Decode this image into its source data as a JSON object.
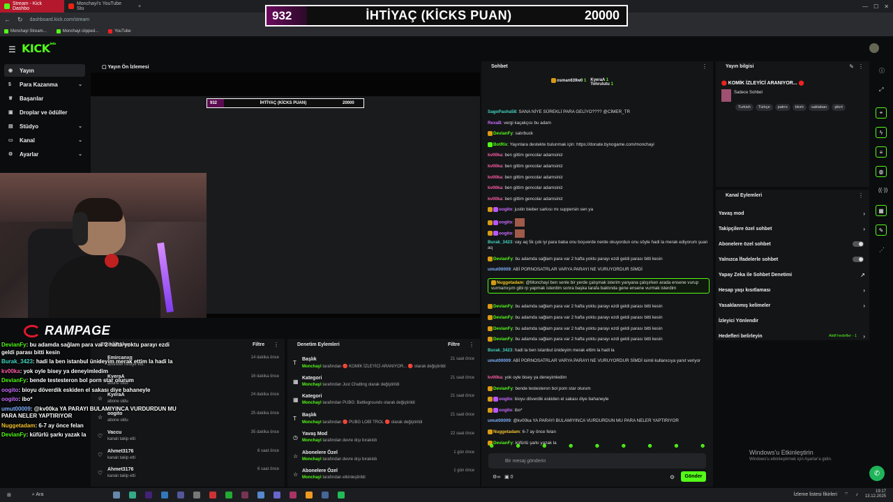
{
  "browser": {
    "tabs": [
      {
        "label": "Stream - Kick Dashbo"
      },
      {
        "label": "Monchayi's YouTube Stu"
      }
    ],
    "url": "dashboard.kick.com/stream",
    "bookmarks": [
      {
        "label": "Monchayi Stream..."
      },
      {
        "label": "Monchayi clipped..."
      },
      {
        "label": "YouTube"
      }
    ]
  },
  "overlay_counter": {
    "current": "932",
    "title": "İHTİYAÇ (KİCKS PUAN)",
    "goal": "20000"
  },
  "kick": {
    "logo": "KICK",
    "logo_sup": "beta"
  },
  "sidebar": {
    "items": [
      {
        "label": "Yayın",
        "icon": "broadcast-icon",
        "expandable": false
      },
      {
        "label": "Para Kazanma",
        "icon": "money-icon",
        "expandable": true
      },
      {
        "label": "Başarılar",
        "icon": "trophy-icon",
        "expandable": false
      },
      {
        "label": "Droplar ve ödüller",
        "icon": "gift-icon",
        "expandable": false
      },
      {
        "label": "Stüdyo",
        "icon": "studio-icon",
        "expandable": true
      },
      {
        "label": "Kanal",
        "icon": "channel-icon",
        "expandable": true
      },
      {
        "label": "Ayarlar",
        "icon": "gear-icon",
        "expandable": true
      }
    ]
  },
  "preview": {
    "title": "Yayın Ön İzlemesi",
    "brand": "RAMPAGE"
  },
  "stream_chat_overlay": [
    {
      "user": "DevianFy",
      "color": "green",
      "text": "bu adamda sağlam para var 2 hafta yoktu parayı ezdi geldi parası bitti kesin"
    },
    {
      "user": "Burak_3423",
      "color": "cyan",
      "text": "hadi la ben istanbul ünideyim merak ettim la hadi la"
    },
    {
      "user": "kv00ka",
      "color": "pink",
      "text": "yok oyle bisey ya deneyimledim"
    },
    {
      "user": "DevianFy",
      "color": "green",
      "text": "bende testesteron bol porn star olurum"
    },
    {
      "user": "oogito",
      "color": "purple",
      "text": "bioyu döverdik eskiden el sakası diye bahaneyle"
    },
    {
      "user": "oogito",
      "color": "purple",
      "text": "ibo*"
    },
    {
      "user": "umut00009",
      "color": "blue",
      "text": "@kv00ka YA PARAYI BULAMIYINCA VURDURDUN MU PARA NELER YAPTIRIYOR"
    },
    {
      "user": "Nuggetadam",
      "color": "yellow",
      "text": "6-7 ay önce felan"
    },
    {
      "user": "DevianFy",
      "color": "green",
      "text": "küfürlü şarkı yazak la"
    }
  ],
  "activity": {
    "title": "Etkinlik Akışı",
    "filter": "Filtre",
    "items": [
      {
        "name": "Emircanxq",
        "sub": "abonelik hediye etti.",
        "time": "14 dakika önce",
        "icon": "gift-icon"
      },
      {
        "name": "KyeraA",
        "sub": "abone oldu",
        "time": "16 dakika önce",
        "icon": "star-icon"
      },
      {
        "name": "KyeraA",
        "sub": "abone oldu",
        "time": "24 dakika önce",
        "icon": "star-icon"
      },
      {
        "name": "oogito",
        "sub": "abone oldu",
        "time": "25 dakika önce",
        "icon": "star-icon"
      },
      {
        "name": "Vaccu",
        "sub": "kanalı takip etti",
        "time": "35 dakika önce",
        "icon": "heart-icon"
      },
      {
        "name": "Ahmet3176",
        "sub": "kanalı takip etti",
        "time": "6 saat önce",
        "icon": "heart-icon"
      },
      {
        "name": "Ahmet3176",
        "sub": "kanalı takip etti",
        "time": "6 saat önce",
        "icon": "heart-icon"
      }
    ]
  },
  "modlog": {
    "title": "Denetim Eylemleri",
    "filter": "Filtre",
    "items": [
      {
        "name": "Başlık",
        "actor": "Monchayi",
        "sub": "tarafından 🔴 KOMİK İZLEYİCİ ARANIYOR... 🔴 olarak değiştirildi",
        "time": "21 saat önce",
        "icon": "title-icon"
      },
      {
        "name": "Kategori",
        "actor": "Monchayi",
        "sub": "tarafından Just Chatting olarak değiştirildi",
        "time": "21 saat önce",
        "icon": "category-icon"
      },
      {
        "name": "Kategori",
        "actor": "Monchayi",
        "sub": "tarafından PUBG: Battlegrounds olarak değiştirildi",
        "time": "21 saat önce",
        "icon": "category-icon"
      },
      {
        "name": "Başlık",
        "actor": "Monchayi",
        "sub": "tarafından 🔴 PUBG LOBİ TROL 🔴 olarak değiştirildi",
        "time": "21 saat önce",
        "icon": "title-icon"
      },
      {
        "name": "Yavaş Mod",
        "actor": "Monchayi",
        "sub": "tarafından devre dışı bırakıldı",
        "time": "22 saat önce",
        "icon": "slow-icon"
      },
      {
        "name": "Abonelere Özel",
        "actor": "Monchayi",
        "sub": "tarafından devre dışı bırakıldı",
        "time": "1 gün önce",
        "icon": "sub-icon"
      },
      {
        "name": "Abonelere Özel",
        "actor": "Monchayi",
        "sub": "tarafından etkinleştirildi",
        "time": "1 gün önce",
        "icon": "sub-icon"
      }
    ]
  },
  "chat": {
    "title": "Sohbet",
    "leaders": [
      {
        "name": "osman639w0",
        "count": "1"
      },
      {
        "name": "KyeraA",
        "count": "1"
      },
      {
        "name": "Tohrulutu",
        "count": "1"
      }
    ],
    "messages": [
      {
        "user": "SagoPasha58",
        "color": "cyan",
        "text": "SANA NİYE SÜREKLİ PARA GELİYO???? @CİMER_TR"
      },
      {
        "user": "RexaB",
        "color": "purple",
        "text": "vergi kaçakçısı bu adam"
      },
      {
        "user": "DevianFy",
        "color": "green",
        "text": "satırbuck"
      },
      {
        "user": "BotRix",
        "color": "green",
        "text": "Yayınlara destekte bulunmak için: https://donate.bynogame.com/monchayi"
      },
      {
        "user": "kv00ka",
        "color": "pink",
        "text": "ben gittim gencolar adamsiniz"
      },
      {
        "user": "kv00ka",
        "color": "pink",
        "text": "ben gittim gencolar adamsiniz"
      },
      {
        "user": "kv00ka",
        "color": "pink",
        "text": "ben gittim gencolar adamsiniz"
      },
      {
        "user": "kv00ka",
        "color": "pink",
        "text": "ben gittim gencolar adamsiniz"
      },
      {
        "user": "kv00ka",
        "color": "pink",
        "text": "ben gittim gencolar adamsiniz"
      },
      {
        "user": "oogito",
        "color": "purple",
        "text": "justin bieber sarkısı mı suppersin sen ya"
      },
      {
        "user": "oogito",
        "color": "purple",
        "text": ""
      },
      {
        "user": "oogito",
        "color": "purple",
        "text": ""
      },
      {
        "user": "Burak_3423",
        "color": "cyan",
        "text": "vay aq 5k çok iyi para baba onu boşverde nerde okuyordun onu söyle hadi la merak ediyorum şuan aq"
      },
      {
        "user": "DevianFy",
        "color": "green",
        "text": "bu adamda sağlam para var 2 hafta yoktu parayı ezdi geldi parası bitti kesin"
      },
      {
        "user": "umut00009",
        "color": "blue",
        "text": "ABİ PORNOSATRLAR VARYA PARAYI NE VURUYORDUR SİMDİ"
      },
      {
        "user": "Nuggetadam",
        "color": "yellow",
        "text": "@Monchayi ben senle bir yerde çalışmak isterim yanyana çalışırken arada ensene vurup vurmamışım gibi rp yapmak isterdim sonra başka tarafa baktında gene ensene vurmak isterdim"
      },
      {
        "user": "DevianFy",
        "color": "green",
        "text": "bu adamda sağlam para var 2 hafta yoktu parayı ezdi geldi parası bitti kesin"
      },
      {
        "user": "DevianFy",
        "color": "green",
        "text": "bu adamda sağlam para var 2 hafta yoktu parayı ezdi geldi parası bitti kesin"
      },
      {
        "user": "DevianFy",
        "color": "green",
        "text": "bu adamda sağlam para var 2 hafta yoktu parayı ezdi geldi parası bitti kesin"
      },
      {
        "user": "DevianFy",
        "color": "green",
        "text": "bu adamda sağlam para var 2 hafta yoktu parayı ezdi geldi parası bitti kesin"
      },
      {
        "user": "Burak_3423",
        "color": "cyan",
        "text": "hadi la ben istanbul ünideyim merak ettim la hadi la"
      },
      {
        "user": "umut00009",
        "color": "blue",
        "text": "ABİ PORNOSATRLAR VARYA PARAYI NE VURUYORDUR SİMDİ isimli kullanıcıya yanıt veriyor"
      },
      {
        "user": "kv00ka",
        "color": "pink",
        "text": "yok oyle bisey ya deneyimledim"
      },
      {
        "user": "DevianFy",
        "color": "green",
        "text": "bende testesteron bol porn star olurum"
      },
      {
        "user": "oogito",
        "color": "purple",
        "text": "bioyu döverdik eskiden el sakası diye bahaneyle"
      },
      {
        "user": "oogito",
        "color": "purple",
        "text": "ibo*"
      },
      {
        "user": "umut00009",
        "color": "blue",
        "text": "@kv00ka YA PARAYI BULAMIYINCA VURDURDUN MU PARA NELER YAPTIRIYOR"
      },
      {
        "user": "Nuggetadam",
        "color": "yellow",
        "text": "6-7 ay önce felan"
      },
      {
        "user": "DevianFy",
        "color": "green",
        "text": "küfürlü şarkı yazak la"
      }
    ],
    "input_placeholder": "Bir mesaj gönderin",
    "send_label": "Gönder",
    "viewer_count": "0"
  },
  "stream_info": {
    "title": "Yayın bilgisi",
    "stream_title": "KOMİK İZLEYİCİ ARANIYOR...",
    "category": "Sadece Sohbet",
    "tags": [
      "Turkish",
      "Türkçe",
      "patrrs",
      "tıkırtı",
      "saklabarı",
      "şikırt"
    ]
  },
  "channel_actions": {
    "title": "Kanal Eylemleri",
    "rows": [
      {
        "label": "Yavaş mod",
        "kind": "chevron"
      },
      {
        "label": "Takipçilere özel sohbet",
        "kind": "chevron"
      },
      {
        "label": "Abonelere özel sohbet",
        "kind": "toggle"
      },
      {
        "label": "Yalnızca İfadelerle sohbet",
        "kind": "toggle"
      },
      {
        "label": "Yapay Zeka ile Sohbet Denetimi",
        "kind": "external"
      },
      {
        "label": "Hesap yaşı kısıtlaması",
        "kind": "chevron"
      },
      {
        "label": "Yasaklanmış kelimeler",
        "kind": "chevron"
      },
      {
        "label": "İzleyici Yönlendir",
        "kind": "none"
      },
      {
        "label": "Hedefleri belirleyin",
        "kind": "chevron",
        "extra": "Aktif hedefler - 1"
      }
    ]
  },
  "windows": {
    "activation_title": "Windows'u Etkinleştirin",
    "activation_sub": "Windows'u etkinleştirmek için Ayarlar'a gidin."
  },
  "taskbar": {
    "search": "Ara",
    "tray_label": "İzleme listesi fikirleri",
    "time": "19:17",
    "date": "13.12.2025"
  },
  "colors": {
    "kick_green": "#53fc18",
    "tab_active": "#b3182c",
    "panel": "#141517"
  }
}
